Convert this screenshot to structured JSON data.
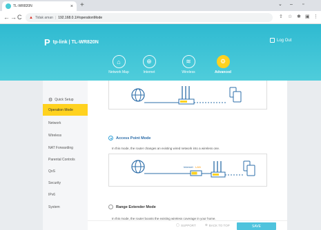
{
  "browser": {
    "tab_title": "TL-WR820N",
    "new_tab": "+",
    "url_warning": "Tidak aman",
    "url": "192.168.0.1/#operationMode"
  },
  "router": {
    "logo_text": "tp-link | TL-WR820N",
    "logout": "Log Out",
    "tabs": [
      {
        "label": "Network Map",
        "icon": "network-icon"
      },
      {
        "label": "Internet",
        "icon": "globe-icon"
      },
      {
        "label": "Wireless",
        "icon": "wifi-icon"
      },
      {
        "label": "Advanced",
        "icon": "gear-icon"
      }
    ],
    "active_tab": "Advanced"
  },
  "sidebar": {
    "items": [
      {
        "label": "Quick Setup"
      },
      {
        "label": "Operation Mode"
      },
      {
        "label": "Network"
      },
      {
        "label": "Wireless"
      },
      {
        "label": "NAT Forwarding"
      },
      {
        "label": "Parental Controls"
      },
      {
        "label": "QoS"
      },
      {
        "label": "Security"
      },
      {
        "label": "IPv6"
      },
      {
        "label": "System"
      }
    ],
    "active": "Operation Mode"
  },
  "modes": [
    {
      "title": "Access Point Mode",
      "selected": true,
      "description": "In this mode, the router changes an existing wired network into a wireless one.",
      "diagram_labels": {
        "internet": "Internet",
        "lan": "LAN"
      }
    },
    {
      "title": "Range Extender Mode",
      "selected": false,
      "description": "In this mode, the router boosts the existing wireless coverage in your home."
    }
  ],
  "footer": {
    "support": "SUPPORT",
    "back_to_top": "BACK TO TOP",
    "save": "SAVE"
  },
  "colors": {
    "header": "#3cc3d6",
    "accent_yellow": "#ffd21f",
    "save_button": "#4fc3dd",
    "mode_title": "#2b6ca8"
  }
}
